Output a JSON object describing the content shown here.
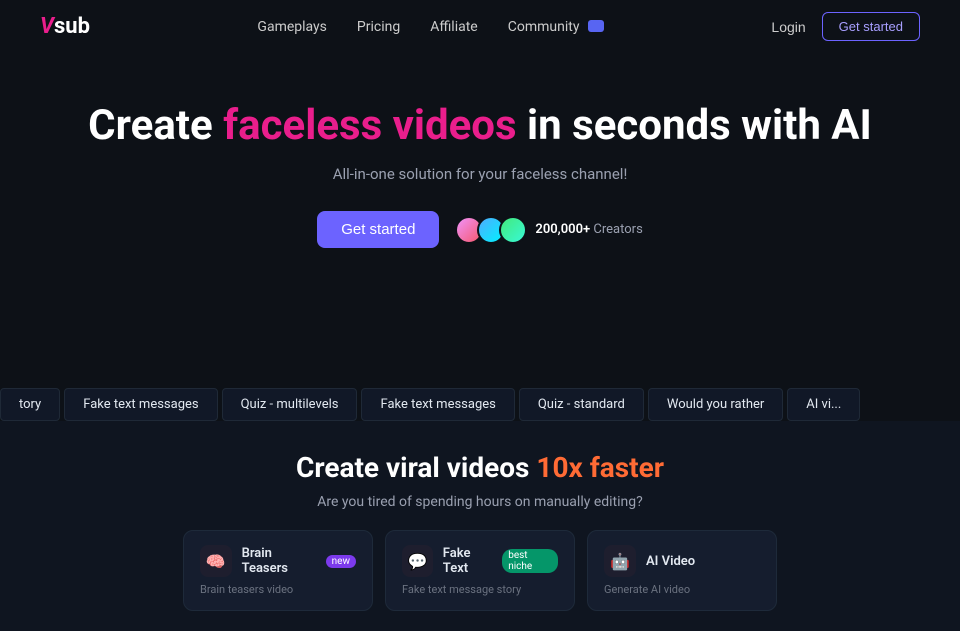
{
  "logo": {
    "v": "V",
    "rest": "sub"
  },
  "nav": {
    "links": [
      {
        "label": "Gameplays",
        "id": "gameplays"
      },
      {
        "label": "Pricing",
        "id": "pricing"
      },
      {
        "label": "Affiliate",
        "id": "affiliate"
      },
      {
        "label": "Community",
        "id": "community"
      }
    ],
    "login": "Login",
    "get_started": "Get started"
  },
  "hero": {
    "title_prefix": "Create ",
    "title_highlight": "faceless videos",
    "title_suffix": " in seconds with AI",
    "subtitle": "All-in-one solution for your faceless channel!",
    "cta_label": "Get started",
    "creators_count": "200,000+",
    "creators_label": "Creators"
  },
  "tags": [
    "tory",
    "Fake text messages",
    "Quiz - multilevels",
    "Fake text messages",
    "Quiz - standard",
    "Would you rather",
    "AI vi..."
  ],
  "bottom": {
    "title_prefix": "Create viral videos ",
    "title_highlight": "10x faster",
    "subtitle": "Are you tired of spending hours on manually editing?"
  },
  "cards": [
    {
      "icon": "🧠",
      "icon_class": "card-icon-brain",
      "title": "Brain Teasers",
      "badge": "new",
      "badge_class": "badge-new",
      "desc": "Brain teasers video"
    },
    {
      "icon": "💬",
      "icon_class": "card-icon-fake",
      "title": "Fake Text",
      "badge": "best niche",
      "badge_class": "badge-niche",
      "desc": "Fake text message story"
    },
    {
      "icon": "🤖",
      "icon_class": "card-icon-ai",
      "title": "AI Video",
      "badge": "",
      "badge_class": "",
      "desc": "Generate AI video"
    }
  ]
}
